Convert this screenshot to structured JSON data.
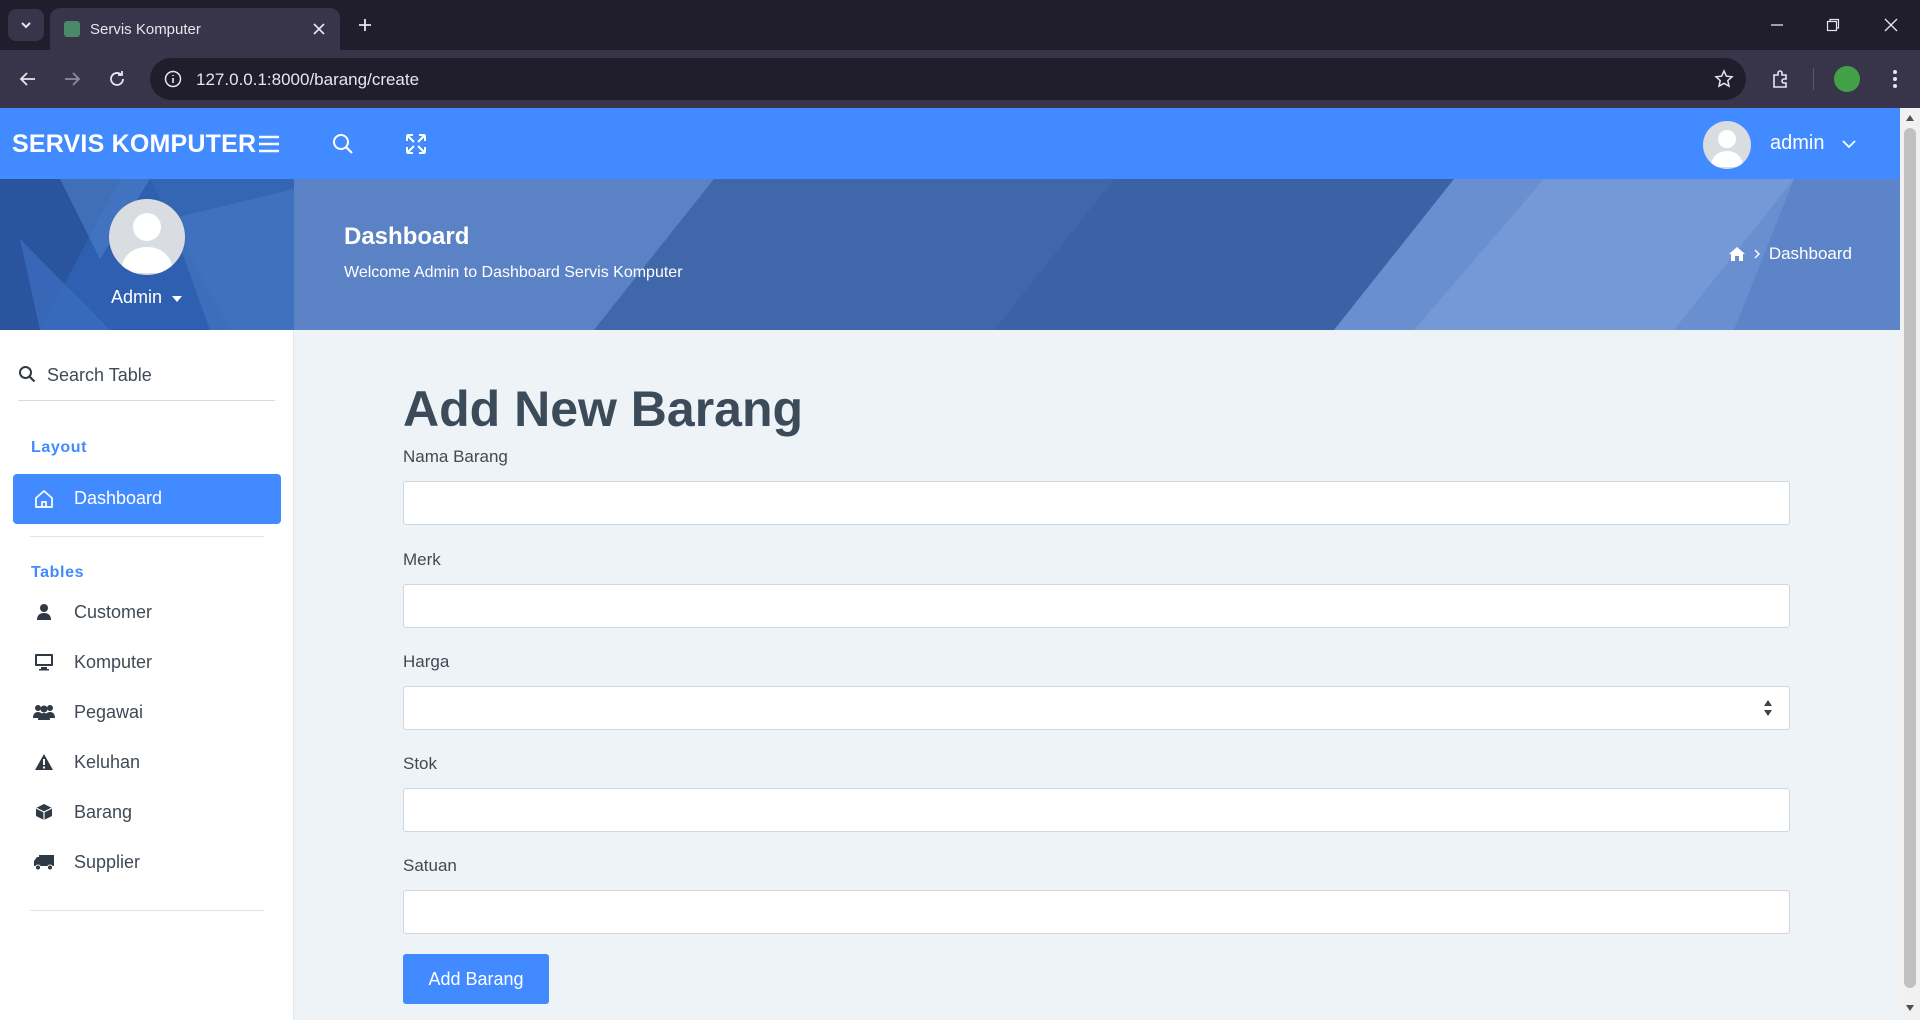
{
  "browser": {
    "tab_title": "Servis Komputer",
    "url": "127.0.0.1:8000/barang/create"
  },
  "header": {
    "brand": "SERVIS KOMPUTER",
    "user_name": "admin",
    "accent_color": "#418aff"
  },
  "sidebar": {
    "profile_name": "Admin",
    "search_placeholder": "Search Table",
    "sections": [
      {
        "heading": "Layout"
      },
      {
        "heading": "Tables"
      }
    ],
    "active_item": {
      "label": "Dashboard",
      "icon": "home-icon"
    },
    "items": [
      {
        "label": "Customer",
        "icon": "user-icon"
      },
      {
        "label": "Komputer",
        "icon": "monitor-icon"
      },
      {
        "label": "Pegawai",
        "icon": "users-icon"
      },
      {
        "label": "Keluhan",
        "icon": "warning-icon"
      },
      {
        "label": "Barang",
        "icon": "box-icon"
      },
      {
        "label": "Supplier",
        "icon": "truck-icon"
      }
    ]
  },
  "banner": {
    "title": "Dashboard",
    "subtitle": "Welcome Admin to Dashboard Servis Komputer",
    "breadcrumb": "Dashboard"
  },
  "form": {
    "title": "Add New Barang",
    "fields": [
      {
        "label": "Nama Barang",
        "value": ""
      },
      {
        "label": "Merk",
        "value": ""
      },
      {
        "label": "Harga",
        "value": ""
      },
      {
        "label": "Stok",
        "value": ""
      },
      {
        "label": "Satuan",
        "value": ""
      }
    ],
    "submit_label": "Add Barang"
  }
}
